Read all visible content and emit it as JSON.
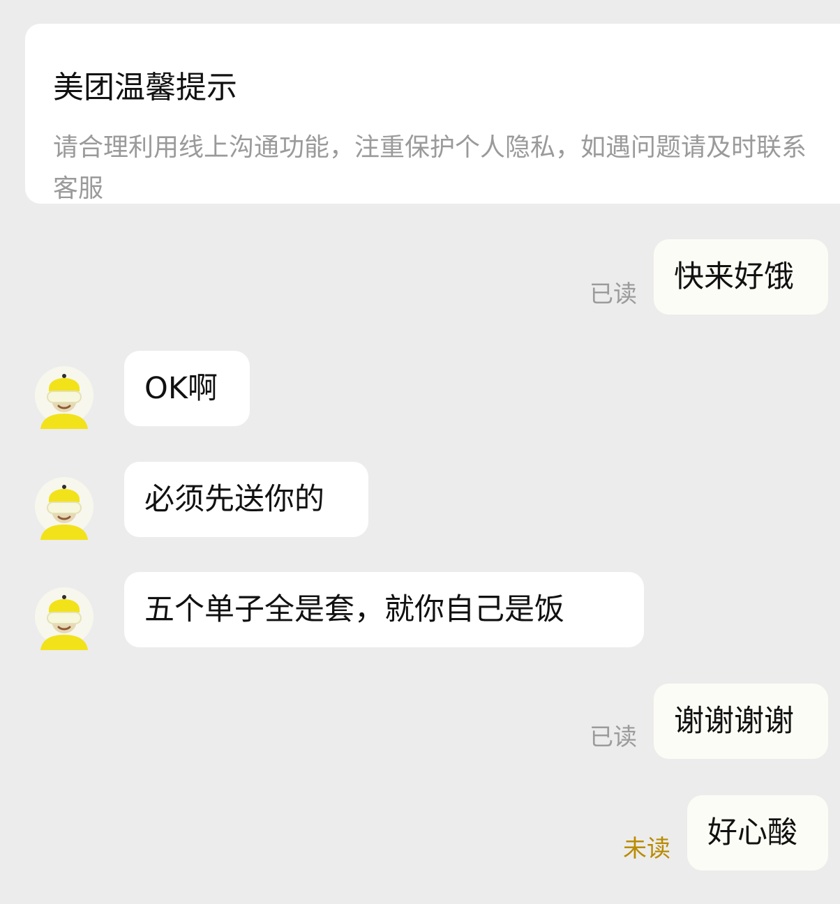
{
  "notice": {
    "title": "美团温馨提示",
    "body_line1": "请合理利用线上沟通功能，注重保护个人隐私，如遇问题请及时联系",
    "body_line2": "客服"
  },
  "messages": [
    {
      "from": "me",
      "text": "快来好饿",
      "status": "已读"
    },
    {
      "from": "rider",
      "text": "OK啊"
    },
    {
      "from": "rider",
      "text": "必须先送你的"
    },
    {
      "from": "rider",
      "text": "五个单子全是套，就你自己是饭"
    },
    {
      "from": "me",
      "text": "谢谢谢谢",
      "status": "已读"
    },
    {
      "from": "me",
      "text": "好心酸",
      "status": "未读"
    }
  ],
  "colors": {
    "background": "#ececec",
    "bubble": "#ffffff",
    "read_status": "#9b9b9b",
    "unread_status": "#b98b00",
    "rider_yellow": "#f2e21a"
  },
  "icons": {
    "rider_avatar": "rider-avatar-icon"
  }
}
